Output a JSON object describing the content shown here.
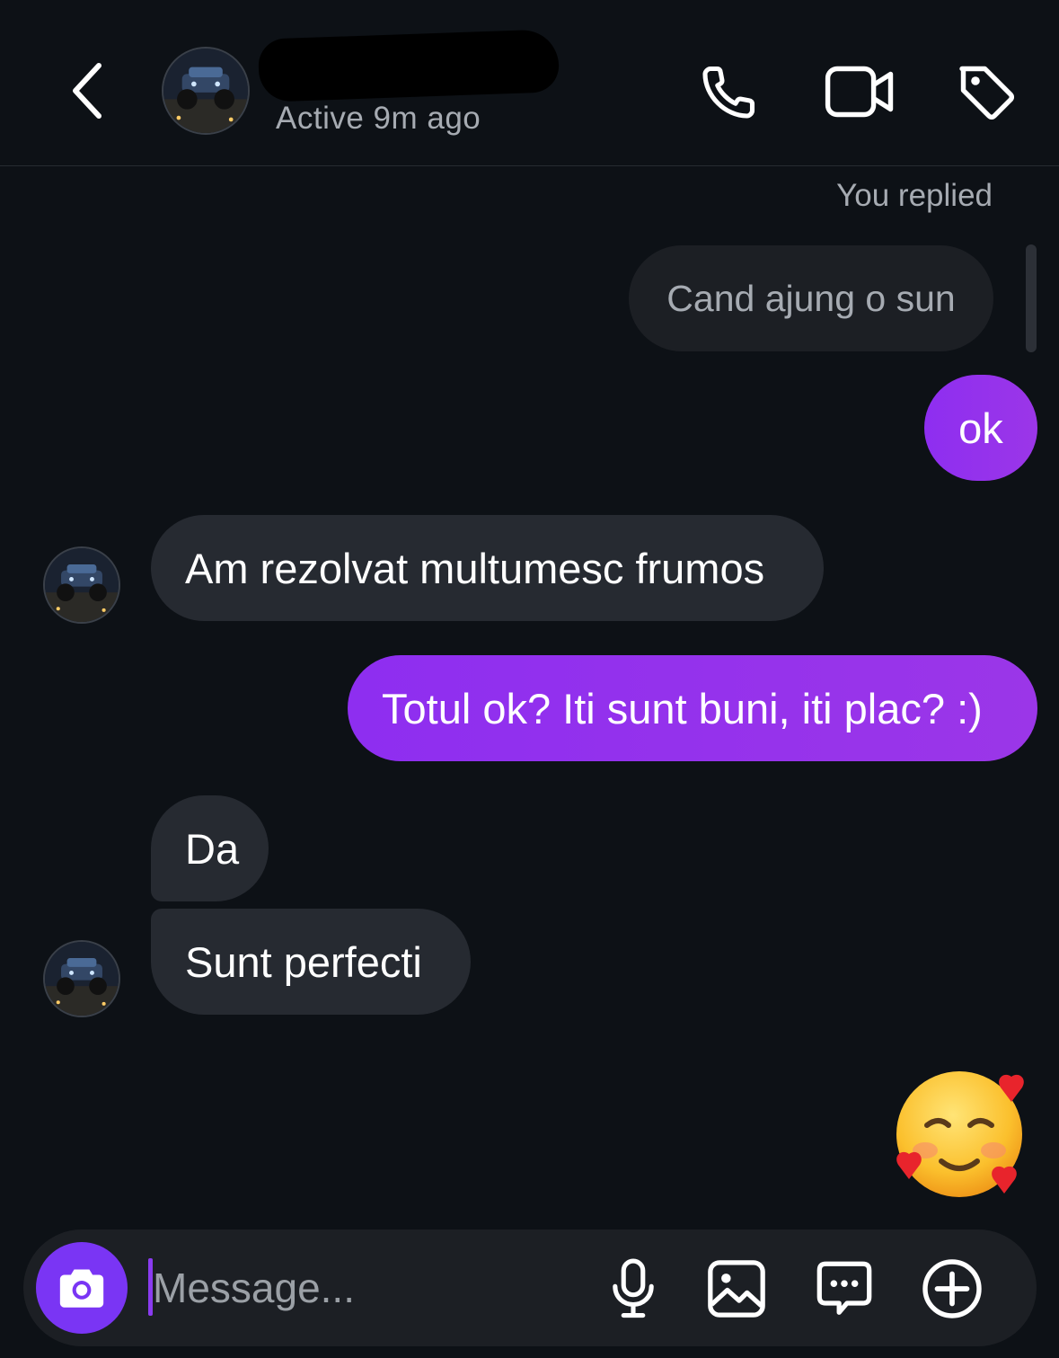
{
  "header": {
    "contact_name": "",
    "status": "Active 9m ago",
    "icons": [
      "back-icon",
      "phone-icon",
      "video-call-icon",
      "tag-icon"
    ]
  },
  "thread": {
    "reply_context_label": "You replied",
    "quoted_message": "Cand ajung o sun",
    "messages": [
      {
        "from": "me",
        "text": "ok"
      },
      {
        "from": "them",
        "text": "Am rezolvat multumesc frumos"
      },
      {
        "from": "me",
        "text": "Totul ok? Iti sunt buni, iti plac? :)"
      },
      {
        "from": "them",
        "text": "Da"
      },
      {
        "from": "them",
        "text": "Sunt perfecti"
      }
    ],
    "reaction_emoji": "smiling-face-with-hearts"
  },
  "composer": {
    "placeholder": "Message...",
    "value": "",
    "icons": [
      "camera-icon",
      "microphone-icon",
      "gallery-icon",
      "sticker-message-icon",
      "add-icon"
    ]
  },
  "colors": {
    "background": "#0d1116",
    "outgoing_bubble": "#9333ea",
    "incoming_bubble": "#262a31",
    "camera_button": "#7a35f4",
    "secondary_text": "#a6abb2"
  }
}
